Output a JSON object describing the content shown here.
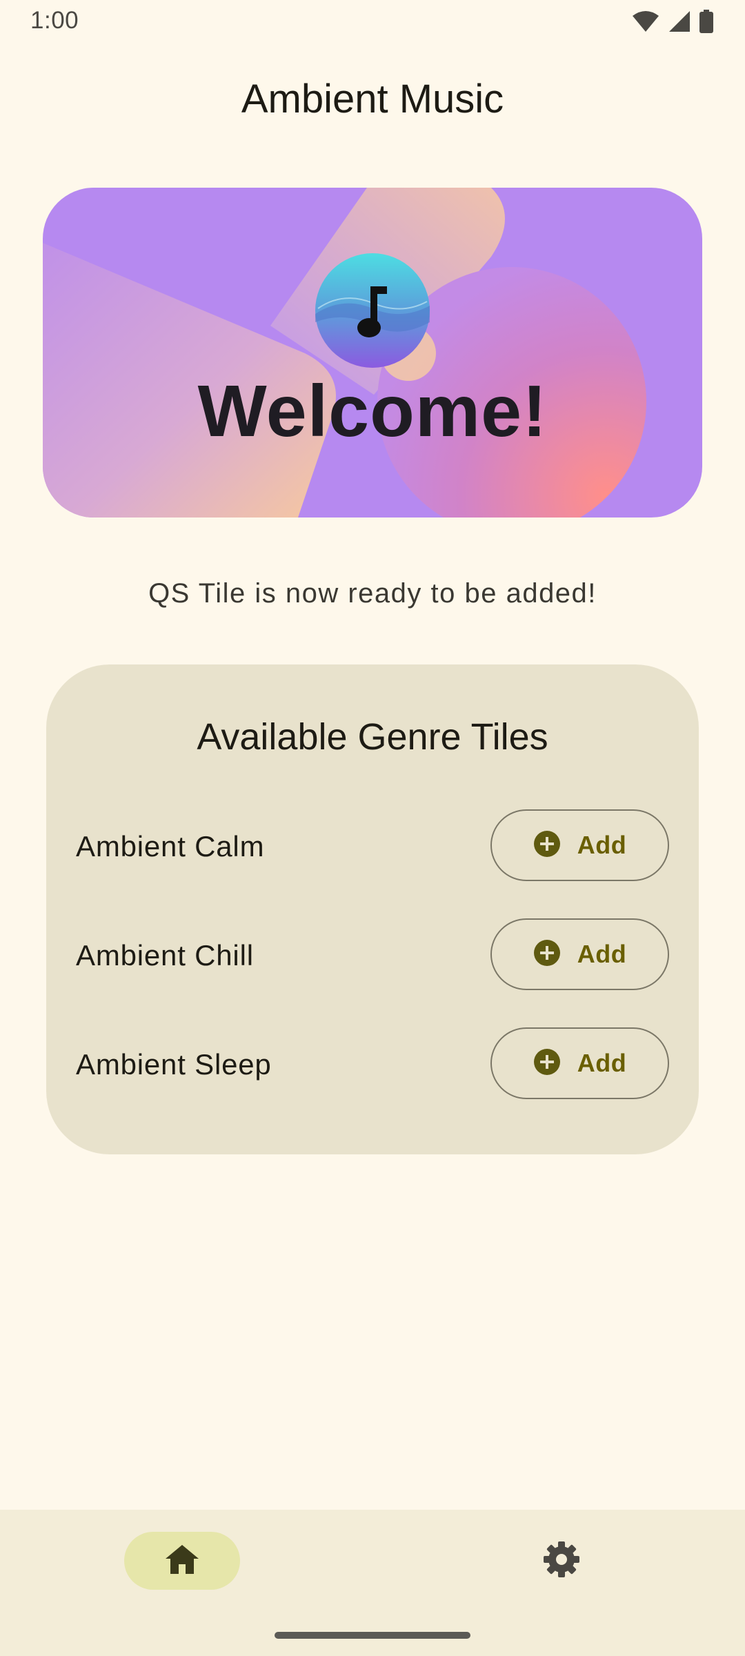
{
  "status_bar": {
    "time": "1:00",
    "icons": [
      "wifi-icon",
      "cell-signal-icon",
      "battery-icon"
    ]
  },
  "app": {
    "title": "Ambient Music"
  },
  "hero": {
    "welcome_text": "Welcome!",
    "logo_icon": "music-note-icon"
  },
  "status_message": "QS Tile is now ready to be added!",
  "genres": {
    "title": "Available Genre Tiles",
    "items": [
      {
        "label": "Ambient Calm",
        "button_label": "Add"
      },
      {
        "label": "Ambient Chill",
        "button_label": "Add"
      },
      {
        "label": "Ambient Sleep",
        "button_label": "Add"
      }
    ]
  },
  "bottom_nav": {
    "items": [
      {
        "icon": "home-icon",
        "selected": true
      },
      {
        "icon": "gear-icon",
        "selected": false
      }
    ]
  },
  "colors": {
    "background": "#FEF8EB",
    "hero_purple": "#B689F0",
    "card": "#E8E2CC",
    "accent": "#6A5F00",
    "nav_bar": "#F3EDD8",
    "nav_selected": "#E6E6AA"
  }
}
